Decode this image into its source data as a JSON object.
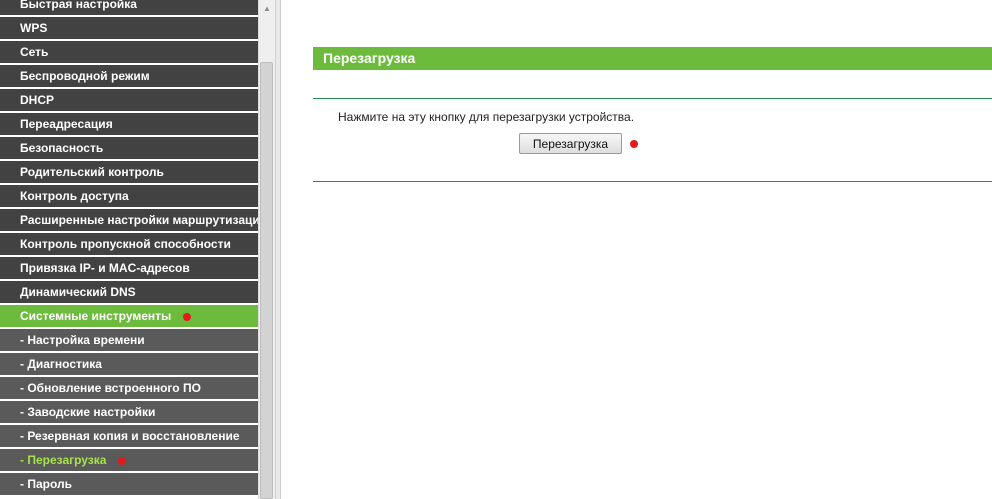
{
  "sidebar": {
    "items": [
      {
        "label": "Быстрая настройка",
        "type": "main"
      },
      {
        "label": "WPS",
        "type": "main"
      },
      {
        "label": "Сеть",
        "type": "main"
      },
      {
        "label": "Беспроводной режим",
        "type": "main"
      },
      {
        "label": "DHCP",
        "type": "main"
      },
      {
        "label": "Переадресация",
        "type": "main"
      },
      {
        "label": "Безопасность",
        "type": "main"
      },
      {
        "label": "Родительский контроль",
        "type": "main"
      },
      {
        "label": "Контроль доступа",
        "type": "main"
      },
      {
        "label": "Расширенные настройки маршрутизации",
        "type": "main"
      },
      {
        "label": "Контроль пропускной способности",
        "type": "main"
      },
      {
        "label": "Привязка IP- и MAC-адресов",
        "type": "main"
      },
      {
        "label": "Динамический DNS",
        "type": "main"
      },
      {
        "label": "Системные инструменты",
        "type": "active",
        "marked": true
      },
      {
        "label": "- Настройка времени",
        "type": "sub"
      },
      {
        "label": "- Диагностика",
        "type": "sub"
      },
      {
        "label": "- Обновление встроенного ПО",
        "type": "sub"
      },
      {
        "label": "- Заводские настройки",
        "type": "sub"
      },
      {
        "label": "- Резервная копия и восстановление",
        "type": "sub"
      },
      {
        "label": "- Перезагрузка",
        "type": "current",
        "marked": true
      },
      {
        "label": "- Пароль",
        "type": "sub"
      }
    ]
  },
  "main": {
    "title": "Перезагрузка",
    "description": "Нажмите на эту кнопку для перезагрузки устройства.",
    "reboot_button_label": "Перезагрузка"
  },
  "colors": {
    "accent_green": "#6cbb3c",
    "menu_dark": "#424242",
    "menu_sub": "#5a5a5a",
    "current_item_text": "#a6e34a",
    "marker_red": "#e21a1a",
    "divider_line": "#2e8b57"
  }
}
